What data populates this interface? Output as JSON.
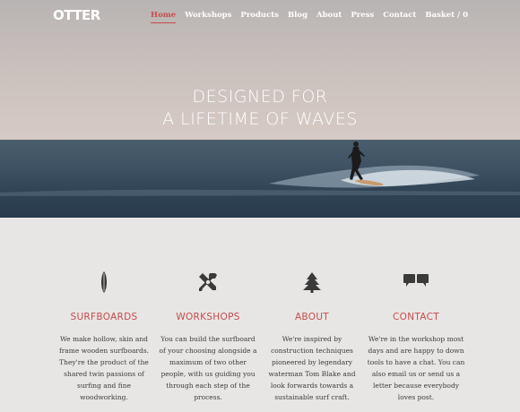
{
  "brand": {
    "logo": "OTTER"
  },
  "nav": {
    "items": [
      "Home",
      "Workshops",
      "Products",
      "Blog",
      "About",
      "Press",
      "Contact",
      "Basket / 0"
    ],
    "active": "Home"
  },
  "hero": {
    "line1": "DESIGNED FOR",
    "line2": "A LIFETIME OF WAVES"
  },
  "features": [
    {
      "icon": "surfboard-icon",
      "title": "SURFBOARDS",
      "text": "We make hollow, skin and frame wooden surfboards. They're the product of the shared twin passions of surfing and fine woodworking."
    },
    {
      "icon": "tools-icon",
      "title": "WORKSHOPS",
      "text": "You can build the surfboard of your choosing alongside a maximum of two other people, with us guiding you through each step of the process."
    },
    {
      "icon": "tree-icon",
      "title": "ABOUT",
      "text": "We're inspired by construction techniques pioneered by legendary waterman Tom Blake and look forwards towards a sustainable surf craft."
    },
    {
      "icon": "speech-bubbles-icon",
      "title": "CONTACT",
      "text": "We're in the workshop most days and are happy to down tools to have a chat. You can also email us or send us a letter because everybody loves post."
    }
  ],
  "colors": {
    "accent": "#c84b4b",
    "page_bg": "#e8e6e5",
    "icon": "#3a3a3a"
  }
}
